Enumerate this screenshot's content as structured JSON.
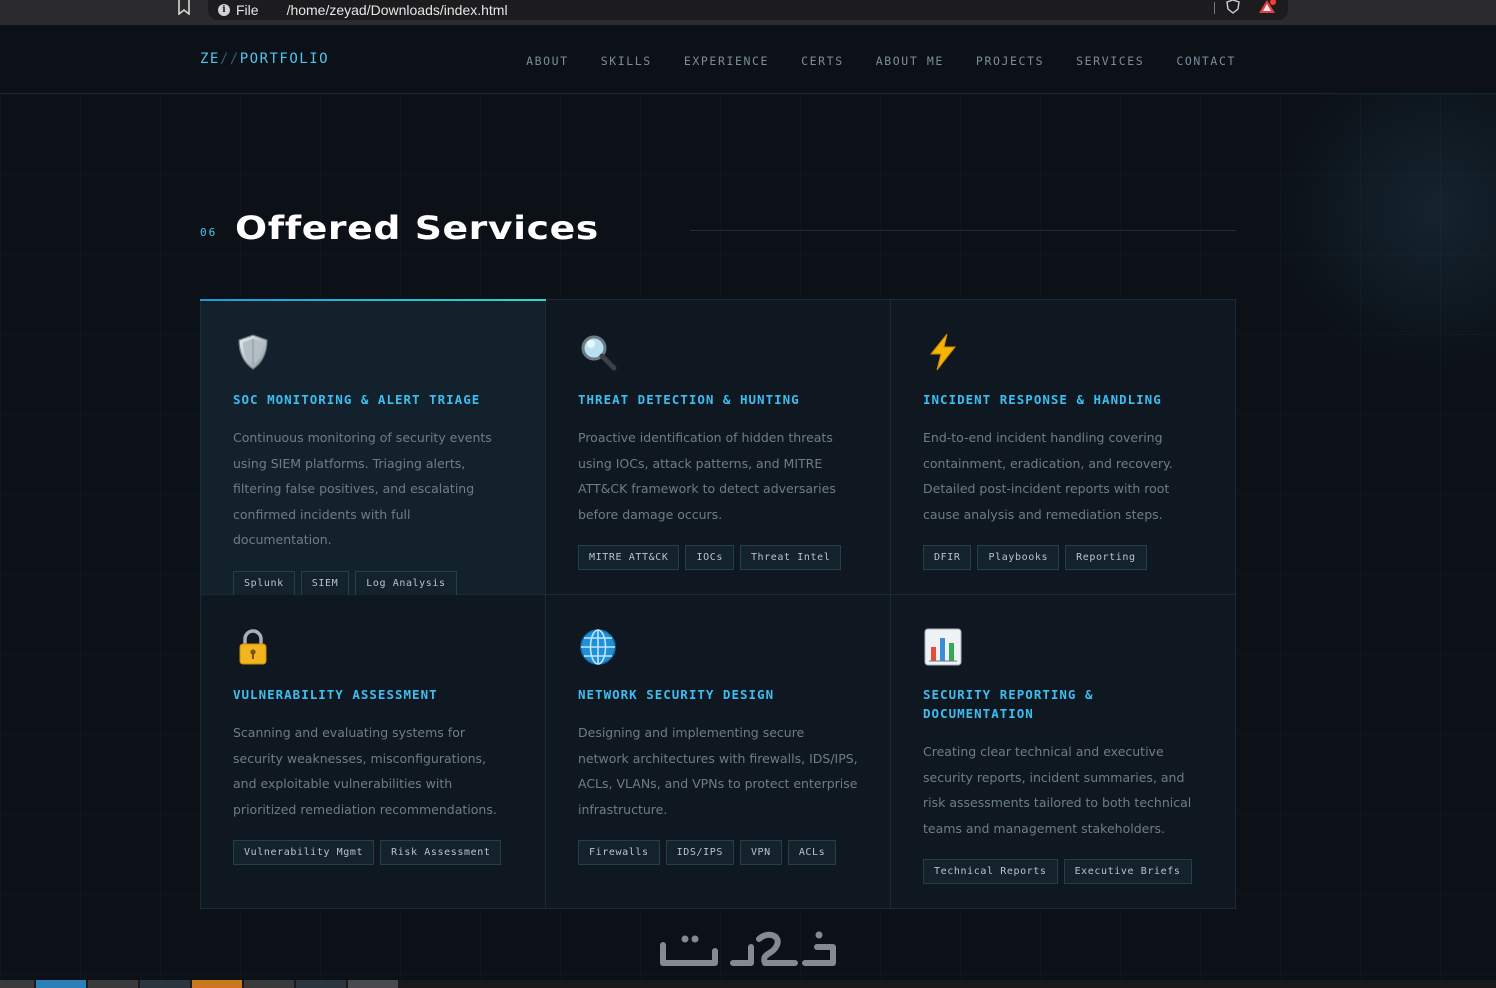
{
  "browser": {
    "file_label": "File",
    "url": "/home/zeyad/Downloads/index.html"
  },
  "logo": {
    "prefix": "ZE",
    "slash": "//",
    "suffix": "PORTFOLIO"
  },
  "nav": [
    "ABOUT",
    "SKILLS",
    "EXPERIENCE",
    "CERTS",
    "ABOUT ME",
    "PROJECTS",
    "SERVICES",
    "CONTACT"
  ],
  "section": {
    "number": "06",
    "title": "Offered Services"
  },
  "services": [
    {
      "icon": "shield-icon",
      "title": "SOC MONITORING & ALERT TRIAGE",
      "description": "Continuous monitoring of security events using SIEM platforms. Triaging alerts, filtering false positives, and escalating confirmed incidents with full documentation.",
      "tags": [
        "Splunk",
        "SIEM",
        "Log Analysis"
      ]
    },
    {
      "icon": "magnifier-icon",
      "title": "THREAT DETECTION & HUNTING",
      "description": "Proactive identification of hidden threats using IOCs, attack patterns, and MITRE ATT&CK framework to detect adversaries before damage occurs.",
      "tags": [
        "MITRE ATT&CK",
        "IOCs",
        "Threat Intel"
      ]
    },
    {
      "icon": "lightning-icon",
      "title": "INCIDENT RESPONSE & HANDLING",
      "description": "End-to-end incident handling covering containment, eradication, and recovery. Detailed post-incident reports with root cause analysis and remediation steps.",
      "tags": [
        "DFIR",
        "Playbooks",
        "Reporting"
      ]
    },
    {
      "icon": "lock-icon",
      "title": "VULNERABILITY ASSESSMENT",
      "description": "Scanning and evaluating systems for security weaknesses, misconfigurations, and exploitable vulnerabilities with prioritized remediation recommendations.",
      "tags": [
        "Vulnerability Mgmt",
        "Risk Assessment"
      ]
    },
    {
      "icon": "globe-icon",
      "title": "NETWORK SECURITY DESIGN",
      "description": "Designing and implementing secure network architectures with firewalls, IDS/IPS, ACLs, VLANs, and VPNs to protect enterprise infrastructure.",
      "tags": [
        "Firewalls",
        "IDS/IPS",
        "VPN",
        "ACLs"
      ]
    },
    {
      "icon": "bar-chart-icon",
      "title": "SECURITY REPORTING & DOCUMENTATION",
      "description": "Creating clear technical and executive security reports, incident summaries, and risk assessments tailored to both technical teams and management stakeholders.",
      "tags": [
        "Technical Reports",
        "Executive Briefs"
      ]
    }
  ],
  "colors": {
    "accent": "#3dbdf0",
    "accent_teal": "#36d6c8",
    "background": "#0b1117",
    "card": "#0f1821"
  }
}
